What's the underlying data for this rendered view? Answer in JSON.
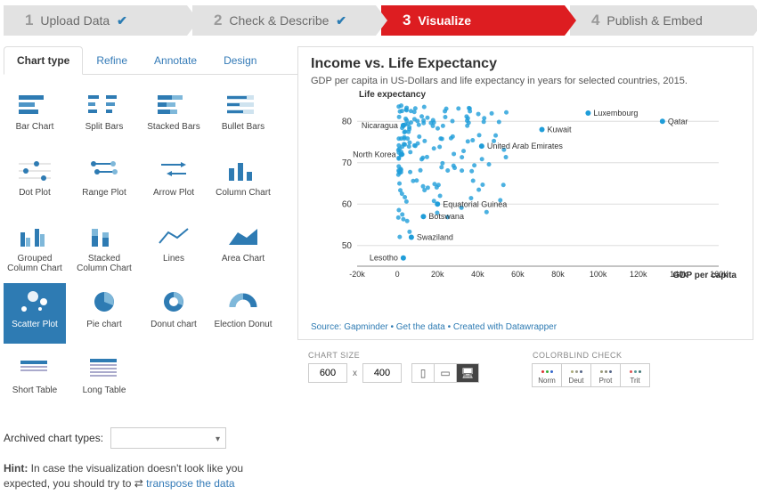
{
  "steps": [
    {
      "num": "1",
      "label": "Upload Data",
      "done": true,
      "active": false
    },
    {
      "num": "2",
      "label": "Check & Describe",
      "done": true,
      "active": false
    },
    {
      "num": "3",
      "label": "Visualize",
      "done": false,
      "active": true
    },
    {
      "num": "4",
      "label": "Publish & Embed",
      "done": false,
      "active": false
    }
  ],
  "tabs": [
    "Chart type",
    "Refine",
    "Annotate",
    "Design"
  ],
  "chartTypes": [
    "Bar Chart",
    "Split Bars",
    "Stacked Bars",
    "Bullet Bars",
    "Dot Plot",
    "Range Plot",
    "Arrow Plot",
    "Column Chart",
    "Grouped Column Chart",
    "Stacked Column Chart",
    "Lines",
    "Area Chart",
    "Scatter Plot",
    "Pie chart",
    "Donut chart",
    "Election Donut",
    "Short Table",
    "Long Table"
  ],
  "selectedChartType": "Scatter Plot",
  "archivedLabel": "Archived chart types:",
  "hintBold": "Hint:",
  "hintText": " In case the visualization doesn't look like you expected, you should try to ",
  "hintLink": "transpose the data",
  "chart": {
    "title": "Income vs. Life Expectancy",
    "subtitle": "GDP per capita in US-Dollars and life expectancy in years for selected countries, 2015.",
    "ylabel": "Life expectancy",
    "xlabel": "GDP per capita",
    "source": "Source: Gapminder • Get the data • Created with Datawrapper"
  },
  "chart_data": {
    "type": "scatter",
    "xlabel": "GDP per capita",
    "ylabel": "Life expectancy",
    "xlim": [
      -20000,
      160000
    ],
    "ylim": [
      45,
      85
    ],
    "xticks": [
      -20000,
      0,
      20000,
      40000,
      60000,
      80000,
      100000,
      120000,
      140000,
      160000
    ],
    "xtick_labels": [
      "-20k",
      "0",
      "20k",
      "40k",
      "60k",
      "80k",
      "100k",
      "120k",
      "140k",
      "160k"
    ],
    "yticks": [
      50,
      60,
      70,
      80
    ],
    "labeled_points": [
      {
        "name": "Luxembourg",
        "x": 95000,
        "y": 82
      },
      {
        "name": "Kuwait",
        "x": 72000,
        "y": 78
      },
      {
        "name": "Qatar",
        "x": 132000,
        "y": 80
      },
      {
        "name": "United Arab Emirates",
        "x": 42000,
        "y": 74
      },
      {
        "name": "Nicaragua",
        "x": 3000,
        "y": 79
      },
      {
        "name": "North Korea",
        "x": 2000,
        "y": 72
      },
      {
        "name": "Equatorial Guinea",
        "x": 20000,
        "y": 60
      },
      {
        "name": "Botswana",
        "x": 13000,
        "y": 57
      },
      {
        "name": "Swaziland",
        "x": 7000,
        "y": 52
      },
      {
        "name": "Lesotho",
        "x": 3000,
        "y": 47
      }
    ],
    "cluster_bounds": {
      "xmin": 500,
      "xmax": 55000,
      "ymin": 50,
      "ymax": 84,
      "approx_count": 150
    }
  },
  "chartSize": {
    "label": "CHART SIZE",
    "w": "600",
    "h": "400",
    "x": "x"
  },
  "colorblind": {
    "label": "COLORBLIND CHECK",
    "modes": [
      "Norm",
      "Deut",
      "Prot",
      "Trit"
    ]
  }
}
